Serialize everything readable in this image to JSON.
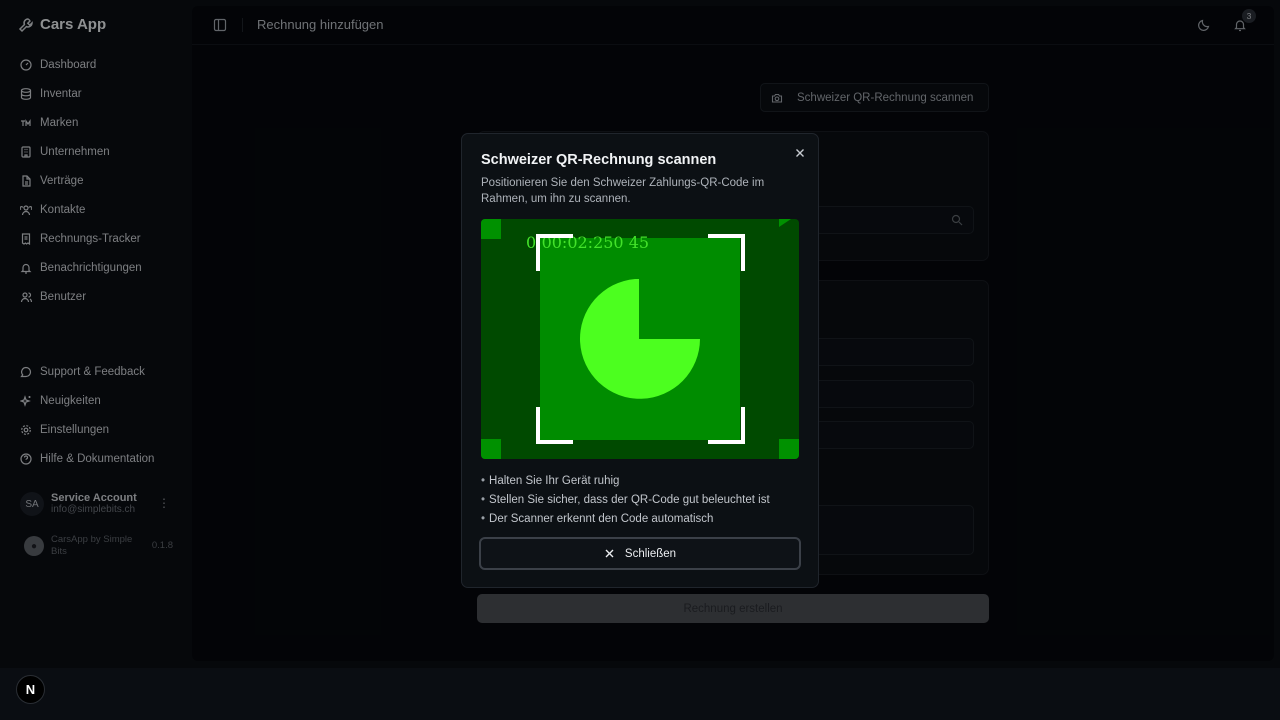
{
  "app": {
    "brand": "Cars App"
  },
  "sidebar": {
    "items": [
      {
        "label": "Dashboard",
        "icon": "dashboard-icon"
      },
      {
        "label": "Inventar",
        "icon": "database-icon"
      },
      {
        "label": "Marken",
        "icon": "trademark-icon"
      },
      {
        "label": "Unternehmen",
        "icon": "building-icon"
      },
      {
        "label": "Verträge",
        "icon": "file-icon"
      },
      {
        "label": "Kontakte",
        "icon": "users-icon"
      },
      {
        "label": "Rechnungs-Tracker",
        "icon": "receipt-icon"
      },
      {
        "label": "Benachrichtigungen",
        "icon": "bell-icon"
      },
      {
        "label": "Benutzer",
        "icon": "user-icon"
      }
    ],
    "secondary": [
      {
        "label": "Support & Feedback",
        "icon": "message-icon"
      },
      {
        "label": "Neuigkeiten",
        "icon": "sparkles-icon"
      },
      {
        "label": "Einstellungen",
        "icon": "gear-icon"
      },
      {
        "label": "Hilfe & Dokumentation",
        "icon": "help-icon"
      }
    ],
    "user": {
      "initials": "SA",
      "name": "Service Account",
      "email": "info@simplebits.ch"
    },
    "footer": {
      "app_text": "CarsApp by Simple Bits",
      "version": "0.1.8"
    }
  },
  "header": {
    "title": "Rechnung hinzufügen",
    "notification_count": "3"
  },
  "main": {
    "scan_button_label": "Schweizer QR-Rechnung scannen",
    "create_button_label": "Rechnung erstellen"
  },
  "modal": {
    "title": "Schweizer QR-Rechnung scannen",
    "description": "Positionieren Sie den Schweizer Zahlungs-QR-Code im Rahmen, um ihn zu scannen.",
    "timecode": "0:00:02:250 45",
    "tips": [
      "Halten Sie Ihr Gerät ruhig",
      "Stellen Sie sicher, dass der QR-Code gut beleuchtet ist",
      "Der Scanner erkennt den Code automatisch"
    ],
    "close_label": "Schließen"
  },
  "framework_badge": "N",
  "colors": {
    "scanner_bg": "#004a00",
    "scanner_inner": "#008c00",
    "pie": "#4cff1f"
  }
}
